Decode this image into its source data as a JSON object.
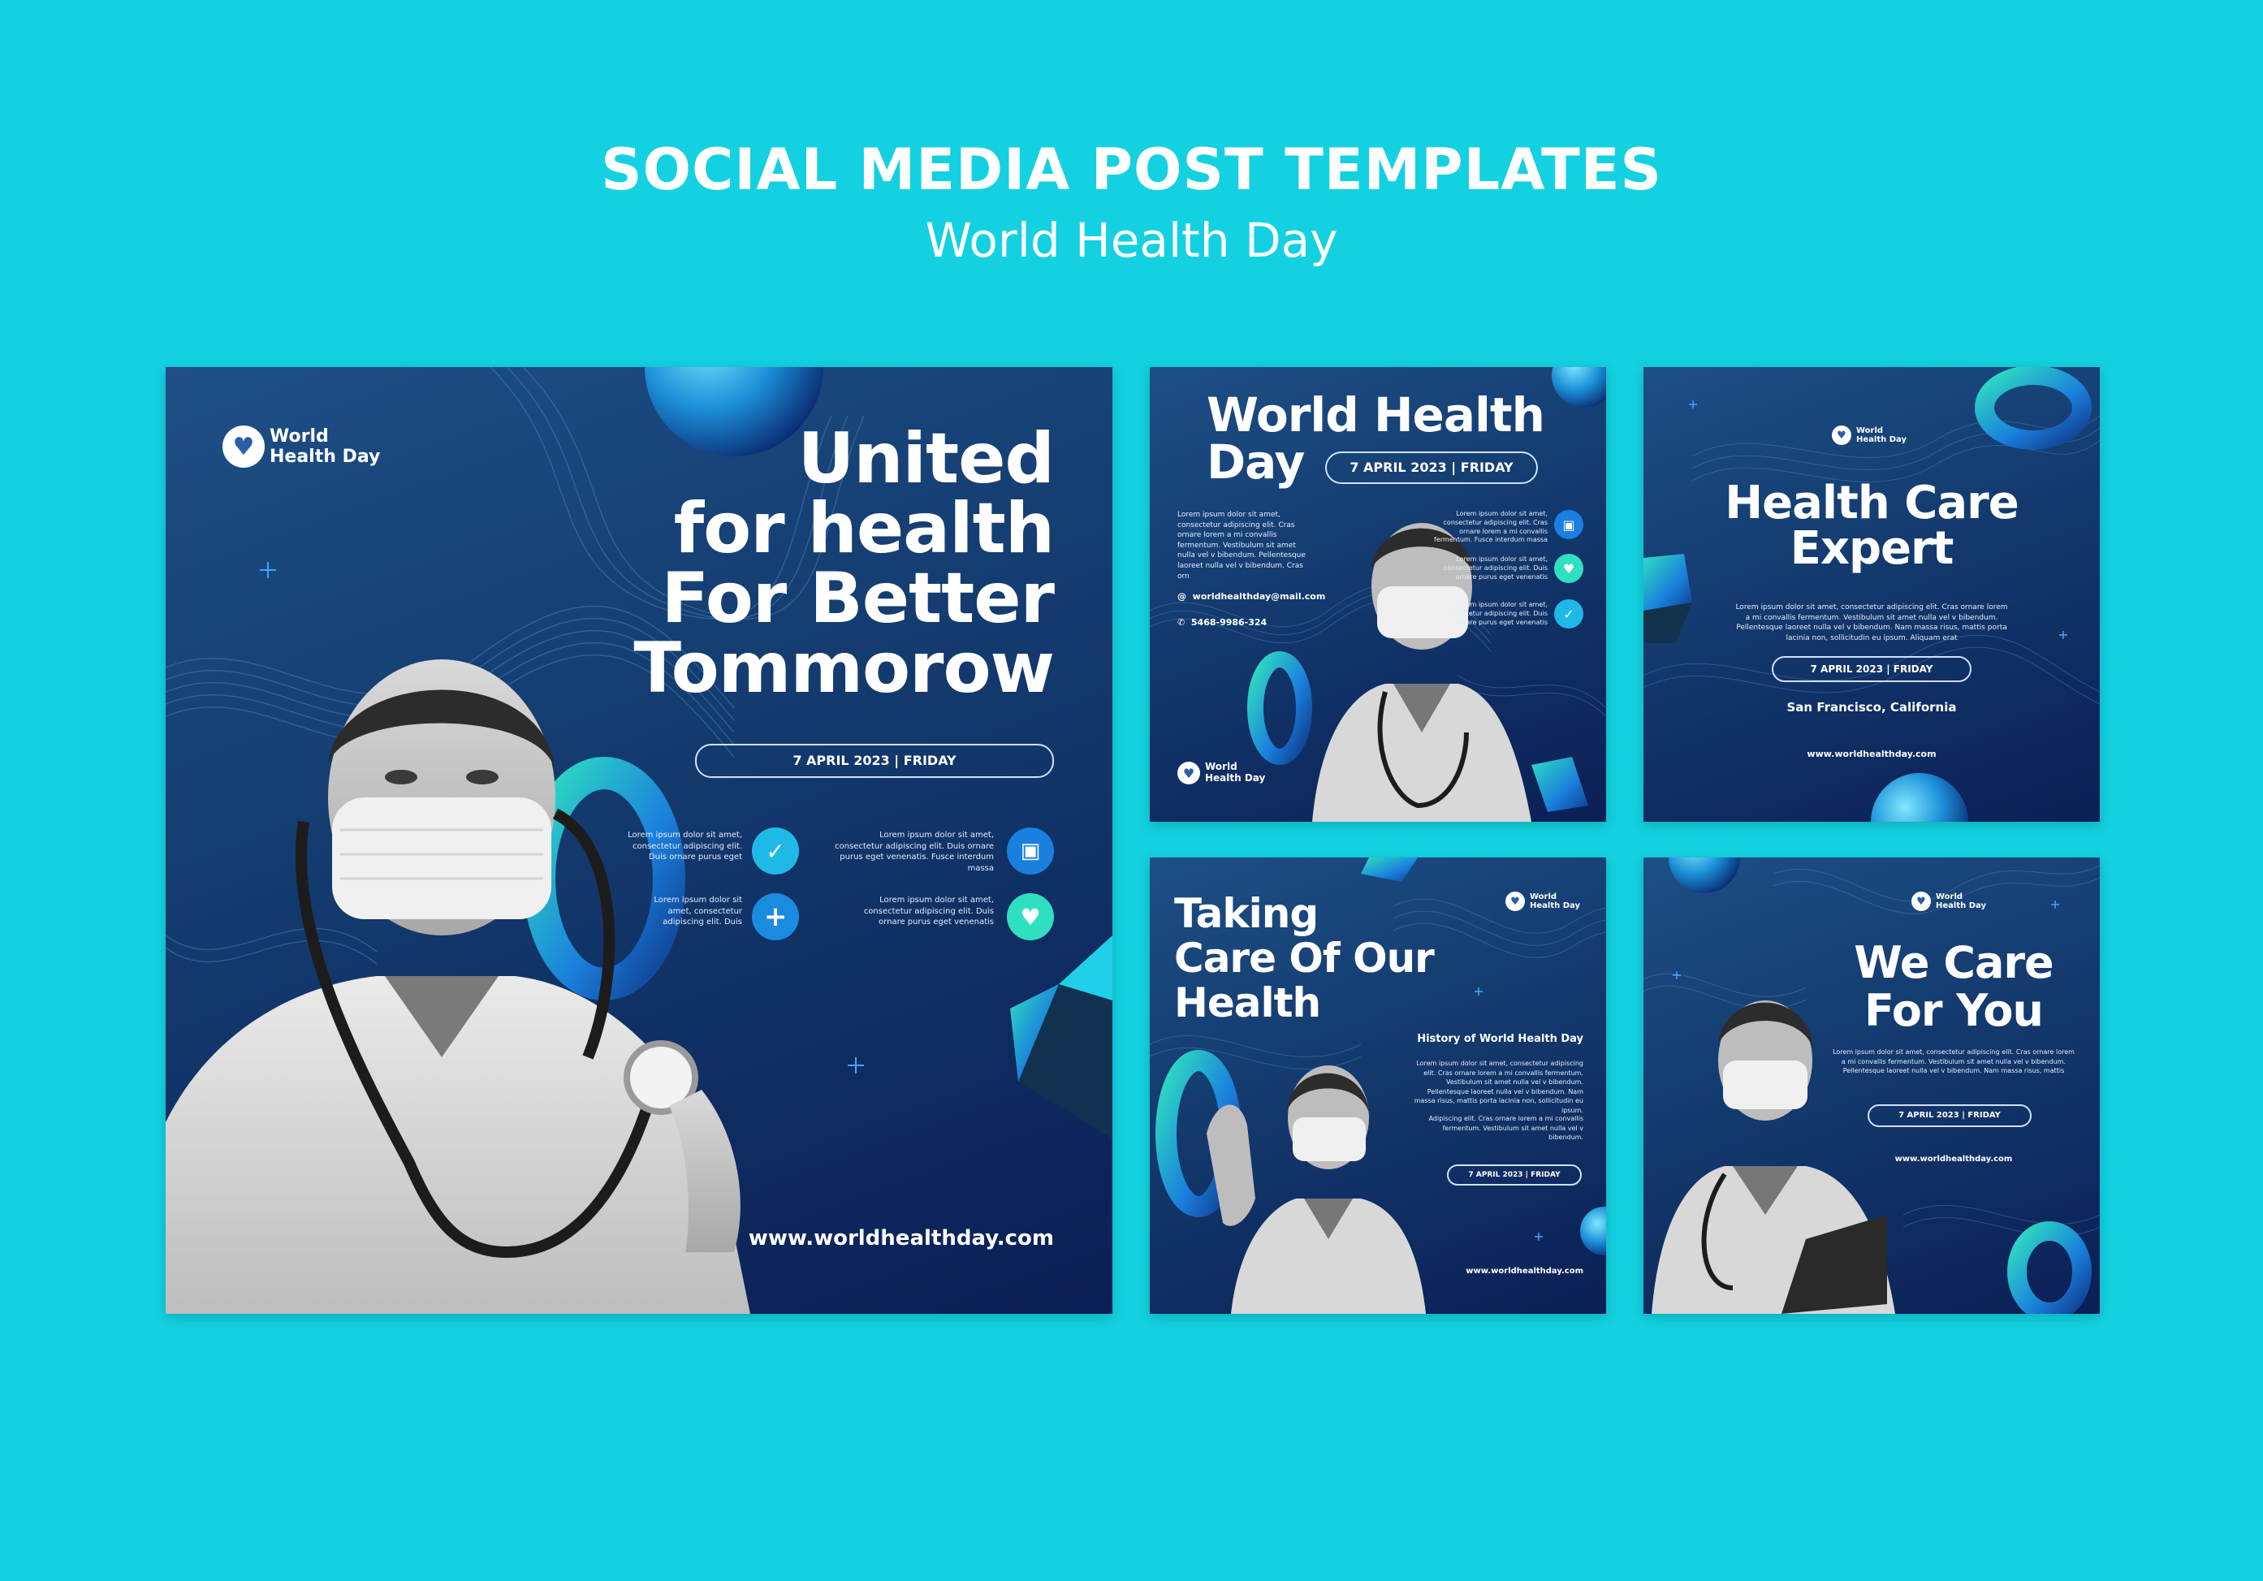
{
  "header": {
    "title": "SOCIAL MEDIA POST TEMPLATES",
    "subtitle": "World Health Day"
  },
  "colors": {
    "background": "#13d1e0",
    "card_dark": "#0b1f55",
    "card_mid": "#1d4f86",
    "accent_cyan": "#26c6f0",
    "accent_teal": "#2fe0c0"
  },
  "logo": {
    "line1": "World",
    "line2": "Health Day",
    "icon": "heart-pulse-icon"
  },
  "post_main": {
    "headline_1": "United",
    "headline_2": "for health",
    "headline_3": "For Better",
    "headline_4": "Tommorow",
    "date": "7 APRIL 2023 | FRIDAY",
    "features": [
      {
        "text": "Lorem ipsum dolor sit amet, consectetur adipiscing elit. Duis ornare purus eget",
        "icon": "shield-check-icon"
      },
      {
        "text": "Lorem ipsum dolor sit amet, consectetur adipiscing elit. Duis ornare purus eget venenatis. Fusce interdum massa",
        "icon": "blood-bag-icon"
      },
      {
        "text": "Lorem ipsum dolor sit amet, consectetur adipiscing elit. Duis",
        "icon": "plus-icon"
      },
      {
        "text": "Lorem ipsum dolor sit amet, consectetur adipiscing elit. Duis ornare purus eget venenatis",
        "icon": "heart-pulse-icon"
      }
    ],
    "website": "www.worldhealthday.com"
  },
  "post_2": {
    "headline_1": "World Health",
    "headline_2": "Day",
    "date": "7 APRIL 2023 | FRIDAY",
    "body": "Lorem ipsum dolor sit amet, consectetur adipiscing elit. Cras ornare lorem a mi convallis fermentum. Vestibulum sit amet nulla vel v bibendum. Pellentesque laoreet nulla vel v bibendum. Cras orn",
    "email": "worldhealthday@mail.com",
    "phone": "5468-9986-324",
    "features": [
      "Lorem ipsum dolor sit amet, consectetur adipiscing elit. Cras ornare lorem a mi convallis fermentum. Fusce interdum massa",
      "Lorem ipsum dolor sit amet, consectetur adipiscing elit. Duis ornare purus eget venenatis",
      "Lorem ipsum dolor sit amet, consectetur adipiscing elit. Duis ornare purus eget venenatis"
    ]
  },
  "post_3": {
    "headline_1": "Health Care",
    "headline_2": "Expert",
    "body": "Lorem ipsum dolor sit amet, consectetur adipiscing elit. Cras ornare lorem a mi convallis fermentum. Vestibulum sit amet nulla vel v bibendum. Pellentesque laoreet nulla vel v bibendum. Nam massa risus, mattis porta lacinia non, sollicitudin eu ipsum. Aliquam erat",
    "date": "7 APRIL 2023 | FRIDAY",
    "location": "San Francisco, California",
    "website": "www.worldhealthday.com"
  },
  "post_4": {
    "headline_1": "Taking",
    "headline_2": "Care Of Our",
    "headline_3": "Health",
    "section_title": "History of World Health Day",
    "body_1": "Lorem ipsum dolor sit amet, consectetur adipiscing elit. Cras ornare lorem a mi convallis fermentum. Vestibulum sit amet nulla vel v bibendum. Pellentesque laoreet nulla vel v bibendum. Nam massa risus, mattis porta lacinia non, sollicitudin eu ipsum.",
    "body_2": "Adipiscing elit. Cras ornare lorem a mi convallis fermentum. Vestibulum sit amet nulla vel v bibendum.",
    "date": "7 APRIL 2023 | FRIDAY",
    "website": "www.worldhealthday.com"
  },
  "post_5": {
    "headline_1": "We Care",
    "headline_2": "For You",
    "body": "Lorem ipsum dolor sit amet, consectetur adipiscing elit. Cras ornare lorem a mi convallis fermentum. Vestibulum sit amet nulla vel v bibendum. Pellentesque laoreet nulla vel v bibendum. Nam massa risus, mattis",
    "date": "7 APRIL 2023 | FRIDAY",
    "website": "www.worldhealthday.com"
  }
}
